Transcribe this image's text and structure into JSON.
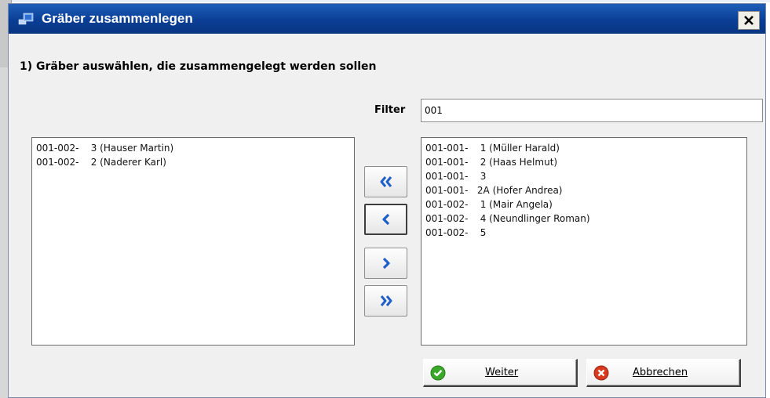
{
  "window": {
    "title": "Gräber zusammenlegen",
    "close_symbol": "✕"
  },
  "section": {
    "heading": "1) Gräber auswählen, die zusammengelegt werden sollen"
  },
  "filter": {
    "label": "Filter",
    "value": "001"
  },
  "left_list": {
    "items": [
      "001-002-    3 (Hauser Martin)",
      "001-002-    2 (Naderer Karl)"
    ]
  },
  "right_list": {
    "items": [
      "001-001-    1 (Müller Harald)",
      "001-001-    2 (Haas Helmut)",
      "001-001-    3",
      "001-001-   2A (Hofer Andrea)",
      "001-002-    1 (Mair Angela)",
      "001-002-    4 (Neundlinger Roman)",
      "001-002-    5"
    ]
  },
  "transfer_buttons": [
    {
      "name": "move-all-left",
      "icon": "double-chevron-left-icon"
    },
    {
      "name": "move-left",
      "icon": "chevron-left-icon"
    },
    {
      "name": "move-right",
      "icon": "chevron-right-icon"
    },
    {
      "name": "move-all-right",
      "icon": "double-chevron-right-icon"
    }
  ],
  "actions": {
    "weiter": {
      "label": "Weiter",
      "icon": "check-circle-icon"
    },
    "abbrechen": {
      "label": "Abbrechen",
      "icon": "cancel-circle-icon"
    }
  },
  "colors": {
    "title_bar": "#0a3e96",
    "arrow": "#1f5fc8",
    "ok_green": "#3aa828",
    "cancel_red": "#d83a20"
  }
}
